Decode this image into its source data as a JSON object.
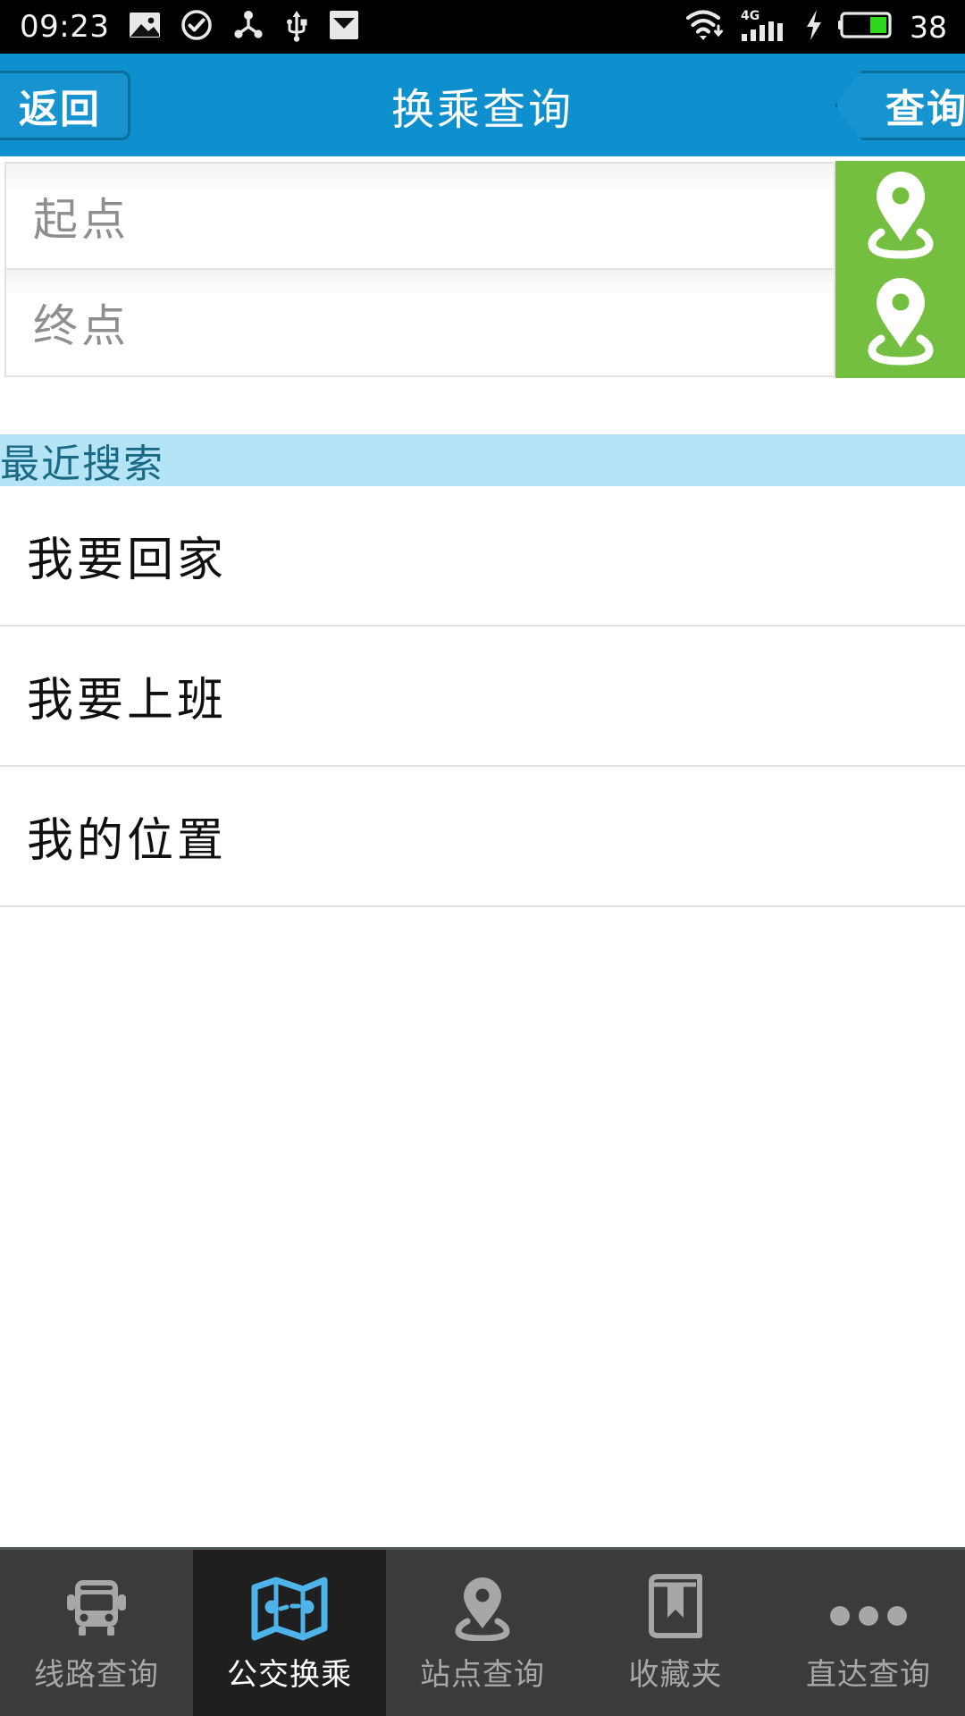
{
  "status_bar": {
    "time": "09:23",
    "battery_percent": "38",
    "network_label": "4G",
    "icons_left": [
      "image-icon",
      "check-circle-icon",
      "share-icon",
      "usb-icon",
      "mail-icon"
    ],
    "icons_right": [
      "wifi-download-icon",
      "signal-4g-icon",
      "charging-bolt-icon",
      "battery-icon"
    ]
  },
  "header": {
    "back_label": "返回",
    "title": "换乘查询",
    "query_label": "查询",
    "background_color": "#0d90cd",
    "border_color": "#0a6e9e"
  },
  "search_form": {
    "origin": {
      "value": "",
      "placeholder": "起点",
      "locate_icon": "map-pin-icon"
    },
    "destination": {
      "value": "",
      "placeholder": "终点",
      "locate_icon": "map-pin-icon"
    },
    "locate_button_color": "#74bf3f"
  },
  "recent": {
    "section_title": "最近搜索",
    "section_bg_color": "#b6e4f7",
    "section_text_color": "#1a6a86",
    "items": [
      {
        "label": "我要回家"
      },
      {
        "label": "我要上班"
      },
      {
        "label": "我的位置"
      }
    ]
  },
  "bottom_nav": {
    "active_color": "#4eb3e8",
    "inactive_color": "#a6a8a8",
    "tabs": [
      {
        "label": "线路查询",
        "icon": "bus-icon",
        "active": false
      },
      {
        "label": "公交换乘",
        "icon": "folded-map-icon",
        "active": true
      },
      {
        "label": "站点查询",
        "icon": "map-pin-icon",
        "active": false
      },
      {
        "label": "收藏夹",
        "icon": "bookmark-book-icon",
        "active": false
      },
      {
        "label": "直达查询",
        "icon": "more-dots-icon",
        "active": false
      }
    ]
  }
}
